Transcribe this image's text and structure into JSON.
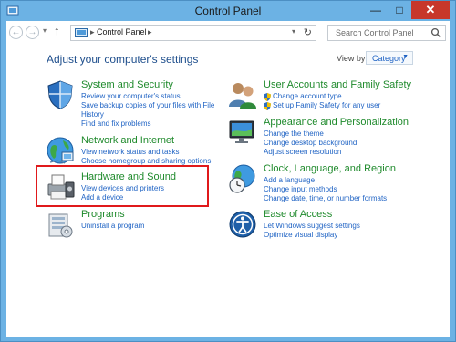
{
  "window": {
    "title": "Control Panel"
  },
  "nav": {
    "back_glyph": "←",
    "forward_glyph": "→",
    "recent_glyph": "▾",
    "up_glyph": "↑"
  },
  "address": {
    "separator": "▸",
    "location": "Control Panel",
    "dropdown_glyph": "▾",
    "refresh_glyph": "↻"
  },
  "search": {
    "placeholder": "Search Control Panel"
  },
  "heading": "Adjust your computer's settings",
  "view_by": {
    "label": "View by:",
    "value": "Category",
    "arrow": "▼"
  },
  "left_categories": [
    {
      "title": "System and Security",
      "icon": "shield-icon",
      "links": [
        "Review your computer's status",
        "Save backup copies of your files with File",
        "History",
        "Find and fix problems"
      ]
    },
    {
      "title": "Network and Internet",
      "icon": "network-globe-icon",
      "links": [
        "View network status and tasks",
        "Choose homegroup and sharing options"
      ]
    },
    {
      "title": "Hardware and Sound",
      "icon": "printer-icon",
      "links": [
        "View devices and printers",
        "Add a device"
      ]
    },
    {
      "title": "Programs",
      "icon": "programs-icon",
      "links": [
        "Uninstall a program"
      ]
    }
  ],
  "right_categories": [
    {
      "title": "User Accounts and Family Safety",
      "icon": "users-icon",
      "links": [
        "Change account type",
        "Set up Family Safety for any user"
      ]
    },
    {
      "title": "Appearance and Personalization",
      "icon": "monitor-icon",
      "links": [
        "Change the theme",
        "Change desktop background",
        "Adjust screen resolution"
      ]
    },
    {
      "title": "Clock, Language, and Region",
      "icon": "clock-globe-icon",
      "links": [
        "Add a language",
        "Change input methods",
        "Change date, time, or number formats"
      ]
    },
    {
      "title": "Ease of Access",
      "icon": "ease-of-access-icon",
      "links": [
        "Let Windows suggest settings",
        "Optimize visual display"
      ]
    }
  ],
  "colors": {
    "frame": "#6cb2e4",
    "heading": "#1e4e8c",
    "category_title": "#1f8a2c",
    "link": "#1f63c4",
    "highlight": "#e0191b",
    "close_button": "#c7372a"
  }
}
